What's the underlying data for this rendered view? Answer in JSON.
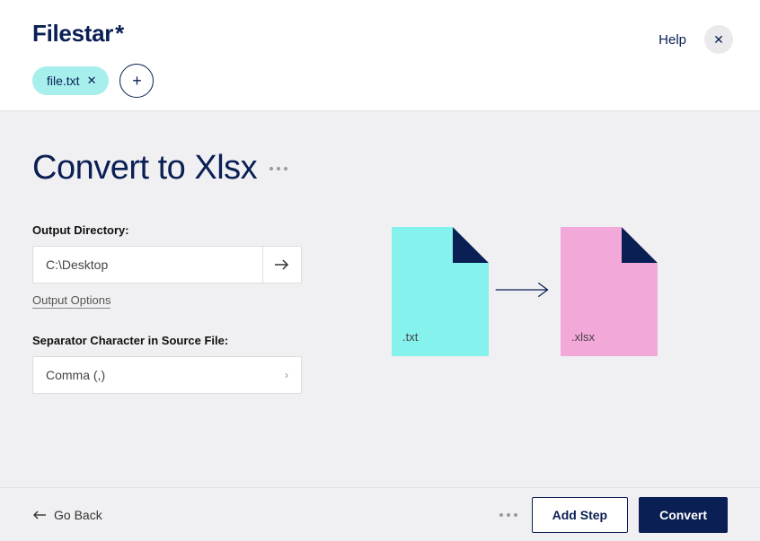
{
  "header": {
    "logo": "Filestar",
    "logo_star": "*",
    "file_chip": "file.txt",
    "help": "Help"
  },
  "main": {
    "title": "Convert to Xlsx",
    "output_dir_label": "Output Directory:",
    "output_dir_value": "C:\\Desktop",
    "output_options": "Output Options",
    "separator_label": "Separator Character in Source File:",
    "separator_value": "Comma (,)"
  },
  "diagram": {
    "src_ext": ".txt",
    "dst_ext": ".xlsx"
  },
  "footer": {
    "go_back": "Go Back",
    "add_step": "Add Step",
    "convert": "Convert"
  }
}
